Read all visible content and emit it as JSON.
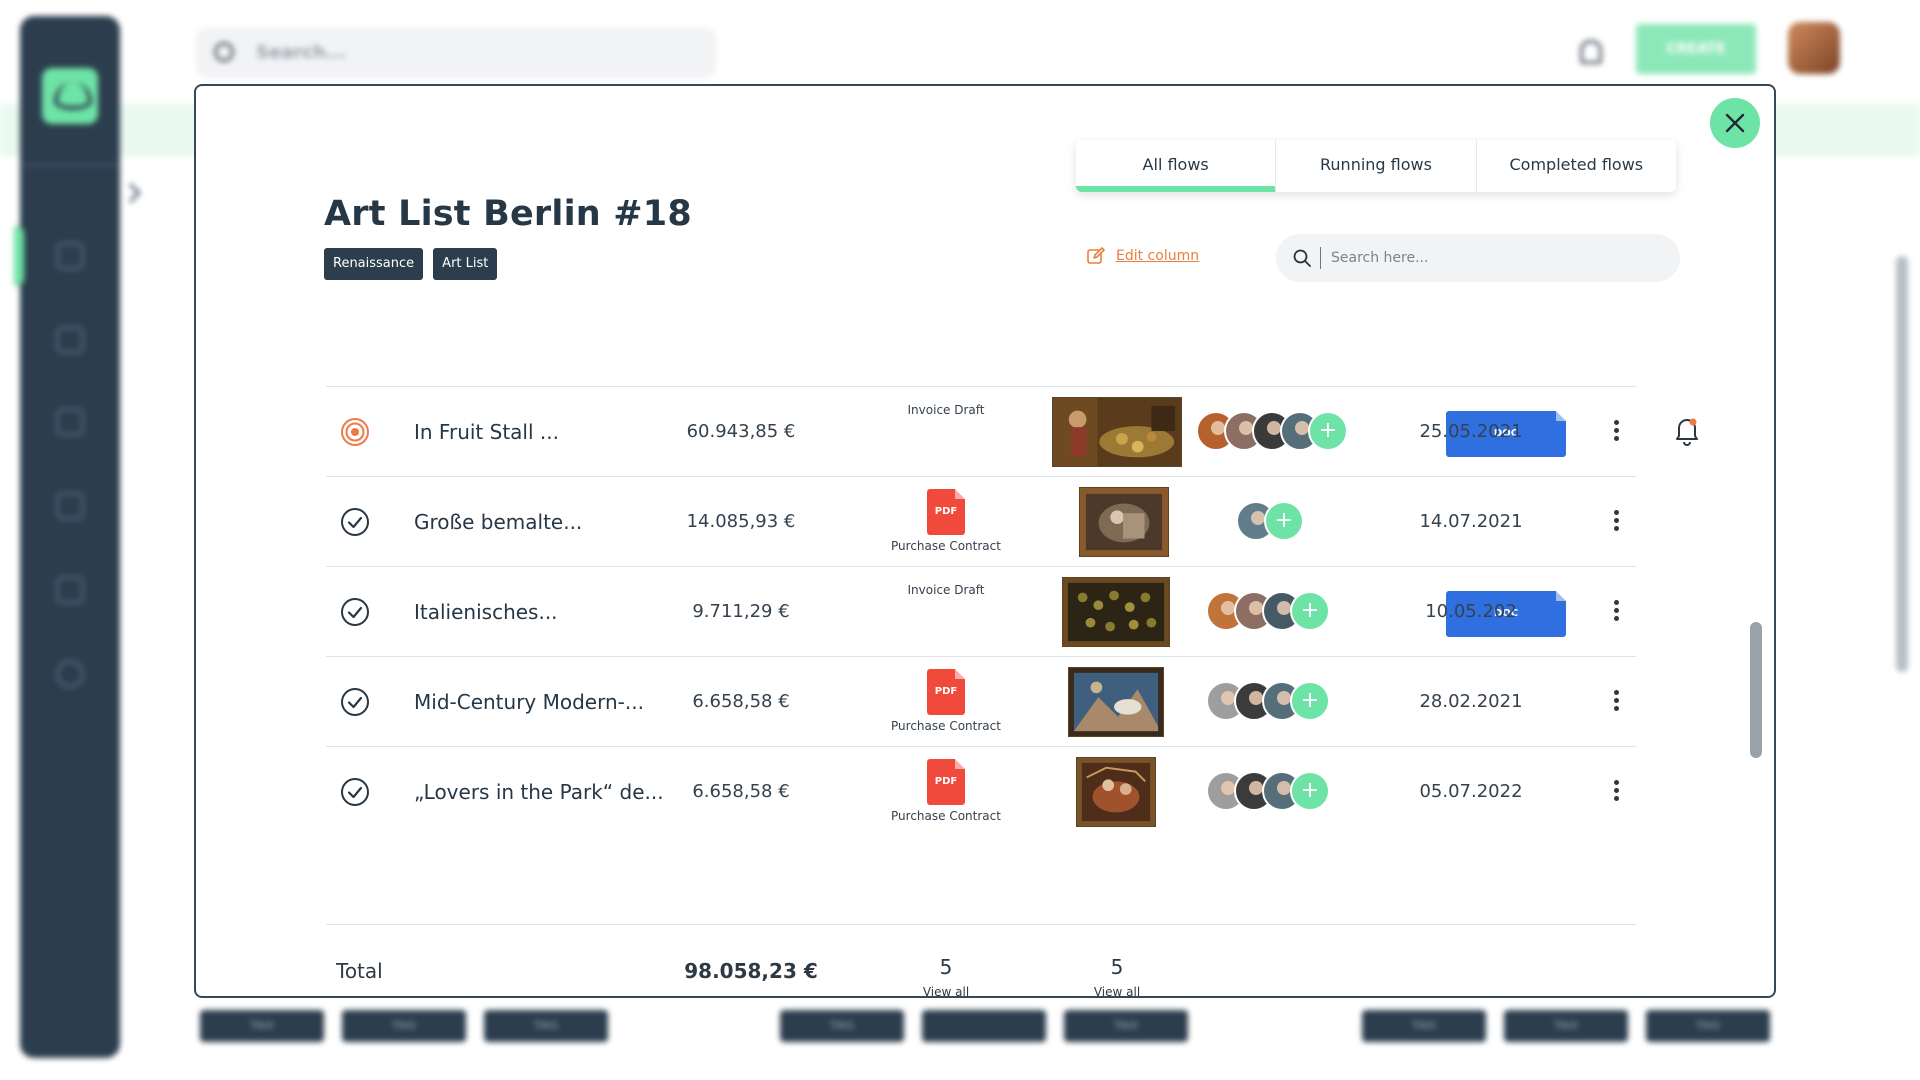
{
  "background": {
    "search_placeholder": "Search...",
    "create_label": "CREATE",
    "bottom_tags": [
      "TAG",
      "TAG",
      "TAG",
      "TAG",
      "",
      "TAG",
      "TAG",
      "TAG",
      "TAG"
    ]
  },
  "modal": {
    "title": "Art List Berlin #18",
    "tags": [
      "Renaissance",
      "Art List"
    ],
    "tabs": [
      {
        "label": "All flows",
        "active": true
      },
      {
        "label": "Running flows",
        "active": false
      },
      {
        "label": "Completed flows",
        "active": false
      }
    ],
    "edit_column_label": "Edit column",
    "table_search_placeholder": "Search here...",
    "rows": [
      {
        "status": "in-progress-target-icon",
        "name": "In Fruit Stall ...",
        "amount": "60.943,85 €",
        "doc_type": "DOC",
        "doc_caption": "Invoice Draft",
        "date": "25.05.2021",
        "has_notification": true
      },
      {
        "status": "check-circle-icon",
        "name": "Große bemalte...",
        "amount": "14.085,93 €",
        "doc_type": "PDF",
        "doc_caption": "Purchase Contract",
        "date": "14.07.2021"
      },
      {
        "status": "check-circle-icon",
        "name": "Italienisches...",
        "amount": "9.711,29 €",
        "doc_type": "DOC",
        "doc_caption": "Invoice Draft",
        "date": "10.05.202"
      },
      {
        "status": "check-circle-icon",
        "name": "Mid-Century Modern-...",
        "amount": "6.658,58 €",
        "doc_type": "PDF",
        "doc_caption": "Purchase Contract",
        "date": "28.02.2021"
      },
      {
        "status": "check-circle-icon",
        "name": "„Lovers in the Park“ de...",
        "amount": "6.658,58 €",
        "doc_type": "PDF",
        "doc_caption": "Purchase Contract",
        "date": "05.07.2022"
      }
    ],
    "total": {
      "label": "Total",
      "amount": "98.058,23 €",
      "documents_count": "5",
      "images_count": "5",
      "view_all_label": "View all"
    }
  },
  "colors": {
    "accent": "#6ee3a6",
    "navy": "#2c3e4e",
    "link_orange": "#e8803e",
    "doc_blue": "#2f6fe0",
    "pdf_red": "#ef4a3c"
  }
}
